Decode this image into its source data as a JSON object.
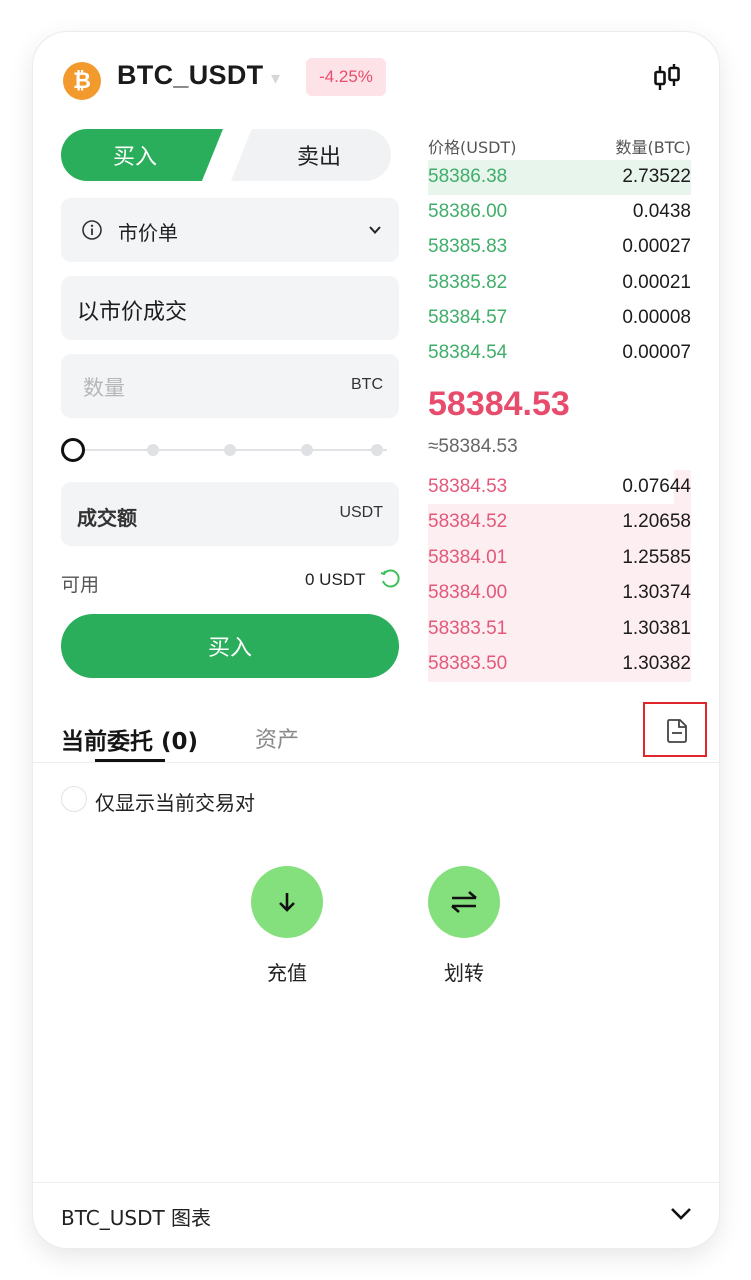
{
  "header": {
    "coin_symbol": "₿",
    "pair": "BTC_USDT",
    "change": "-4.25%",
    "chart_icon": "candlestick-chart-icon"
  },
  "trade_form": {
    "buy_tab": "买入",
    "sell_tab": "卖出",
    "order_type": "市价单",
    "market_price_text": "以市价成交",
    "amount_placeholder": "数量",
    "amount_unit": "BTC",
    "slider_value_percent": 0,
    "turnover_label": "成交额",
    "turnover_unit": "USDT",
    "available_label": "可用",
    "available_value": "0 USDT",
    "buy_button": "买入"
  },
  "order_book": {
    "price_header": "价格(USDT)",
    "qty_header": "数量(BTC)",
    "bids": [
      {
        "price": "58386.38",
        "qty": "2.73522"
      },
      {
        "price": "58386.00",
        "qty": "0.0438"
      },
      {
        "price": "58385.83",
        "qty": "0.00027"
      },
      {
        "price": "58385.82",
        "qty": "0.00021"
      },
      {
        "price": "58384.57",
        "qty": "0.00008"
      },
      {
        "price": "58384.54",
        "qty": "0.00007"
      }
    ],
    "last_price": "58384.53",
    "approx_price": "≈58384.53",
    "asks": [
      {
        "price": "58384.53",
        "qty": "0.07644"
      },
      {
        "price": "58384.52",
        "qty": "1.20658"
      },
      {
        "price": "58384.01",
        "qty": "1.25585"
      },
      {
        "price": "58384.00",
        "qty": "1.30374"
      },
      {
        "price": "58383.51",
        "qty": "1.30381"
      },
      {
        "price": "58383.50",
        "qty": "1.30382"
      }
    ]
  },
  "tabs": {
    "current_orders": "当前委托 (0)",
    "assets": "资产"
  },
  "filter": {
    "label": "仅显示当前交易对"
  },
  "actions": {
    "deposit": "充值",
    "transfer": "划转"
  },
  "footer": {
    "chart_label": "BTC_USDT 图表"
  },
  "colors": {
    "buy_green": "#2aae5b",
    "bid_text": "#3fae69",
    "ask_text": "#e4587a",
    "last_price": "#e74c6d",
    "action_green": "#84e07c",
    "highlight_box": "#e0252b"
  }
}
